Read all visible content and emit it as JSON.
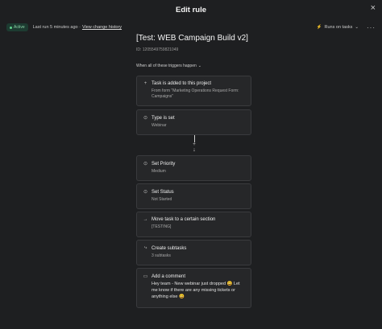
{
  "header": {
    "title": "Edit rule",
    "close_icon": "close-icon"
  },
  "toolbar": {
    "status": "Active",
    "last_run": "Last run 5 minutes ago ·",
    "history_link": "View change history",
    "runs_on": "Runs on tasks",
    "more": "···"
  },
  "rule": {
    "title": "[Test: WEB Campaign Build v2]",
    "id": "ID: 1205549759821049",
    "trigger_mode": "When all of these triggers happen"
  },
  "triggers": [
    {
      "icon": "plus-icon",
      "title": "Task is added to this project",
      "detail": "From form \"Marketing Operations Request Form: Campaigns\""
    },
    {
      "icon": "circle-dot-icon",
      "title": "Type is set",
      "detail": "Webinar"
    }
  ],
  "actions": [
    {
      "icon": "circle-dot-icon",
      "title": "Set Priority",
      "detail": "Medium"
    },
    {
      "icon": "circle-dot-icon",
      "title": "Set Status",
      "detail": "Not Started"
    },
    {
      "icon": "arrow-right-icon",
      "title": "Move task to a certain section",
      "detail": "[TESTING]"
    },
    {
      "icon": "subtasks-icon",
      "title": "Create subtasks",
      "detail": "3 subtasks"
    },
    {
      "icon": "comment-icon",
      "title": "Add a comment",
      "detail": "Hey team - New webinar just dropped 😀 Let me know if there are any missing tickets or anything else 😀"
    }
  ]
}
